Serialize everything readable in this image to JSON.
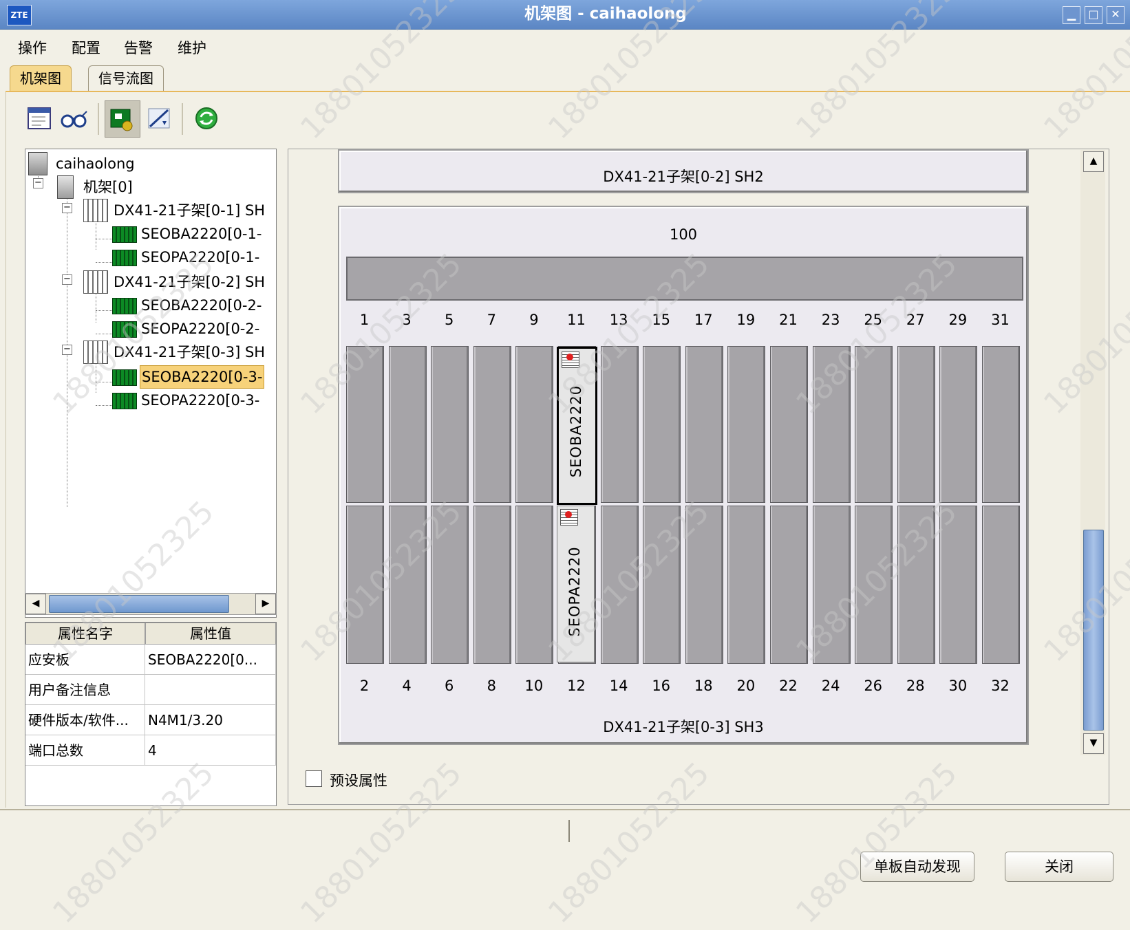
{
  "window": {
    "title": "机架图 - caihaolong",
    "logo": "ZTE",
    "buttons": [
      "minimize-icon",
      "maximize-icon",
      "close-icon"
    ]
  },
  "menu": [
    "操作",
    "配置",
    "告警",
    "维护"
  ],
  "tabs": [
    {
      "label": "机架图",
      "active": true
    },
    {
      "label": "信号流图",
      "active": false
    }
  ],
  "toolbar": [
    "window-icon",
    "glasses-icon",
    "board-select-icon",
    "slash-icon",
    "refresh-icon"
  ],
  "tree": {
    "root": "caihaolong",
    "rack": "机架[0]",
    "subracks": [
      {
        "label": "DX41-21子架[0-1] SH",
        "boards": [
          "SEOBA2220[0-1-",
          "SEOPA2220[0-1-"
        ]
      },
      {
        "label": "DX41-21子架[0-2] SH",
        "boards": [
          "SEOBA2220[0-2-",
          "SEOPA2220[0-2-"
        ]
      },
      {
        "label": "DX41-21子架[0-3] SH",
        "boards": [
          "SEOBA2220[0-3-",
          "SEOPA2220[0-3-"
        ]
      }
    ],
    "selected": "SEOBA2220[0-3-"
  },
  "properties": {
    "headers": [
      "属性名字",
      "属性值"
    ],
    "rows": [
      [
        "应安板",
        "SEOBA2220[0..."
      ],
      [
        "用户备注信息",
        ""
      ],
      [
        "硬件版本/软件...",
        "N4M1/3.20"
      ],
      [
        "端口总数",
        "4"
      ]
    ]
  },
  "view": {
    "top_subrack_label": "DX41-21子架[0-2] SH2",
    "main_subrack_label": "DX41-21子架[0-3] SH3",
    "fan_label": "100",
    "top_slots": [
      "1",
      "3",
      "5",
      "7",
      "9",
      "11",
      "13",
      "15",
      "17",
      "19",
      "21",
      "23",
      "25",
      "27",
      "29",
      "31"
    ],
    "bottom_slots": [
      "2",
      "4",
      "6",
      "8",
      "10",
      "12",
      "14",
      "16",
      "18",
      "20",
      "22",
      "24",
      "26",
      "28",
      "30",
      "32"
    ],
    "cards": [
      {
        "slot": "11",
        "label": "SEOBA2220",
        "selected": true
      },
      {
        "slot": "12",
        "label": "SEOPA2220",
        "selected": false
      }
    ],
    "preset_label": "预设属性"
  },
  "footer": {
    "discover_button": "单板自动发现",
    "close_button": "关闭"
  },
  "watermark": "18801052325",
  "colors": {
    "titlebar": "#5b86c4",
    "tab_active": "#f6d98e",
    "selection": "#f7d27a",
    "slot": "#a6a4a8"
  }
}
